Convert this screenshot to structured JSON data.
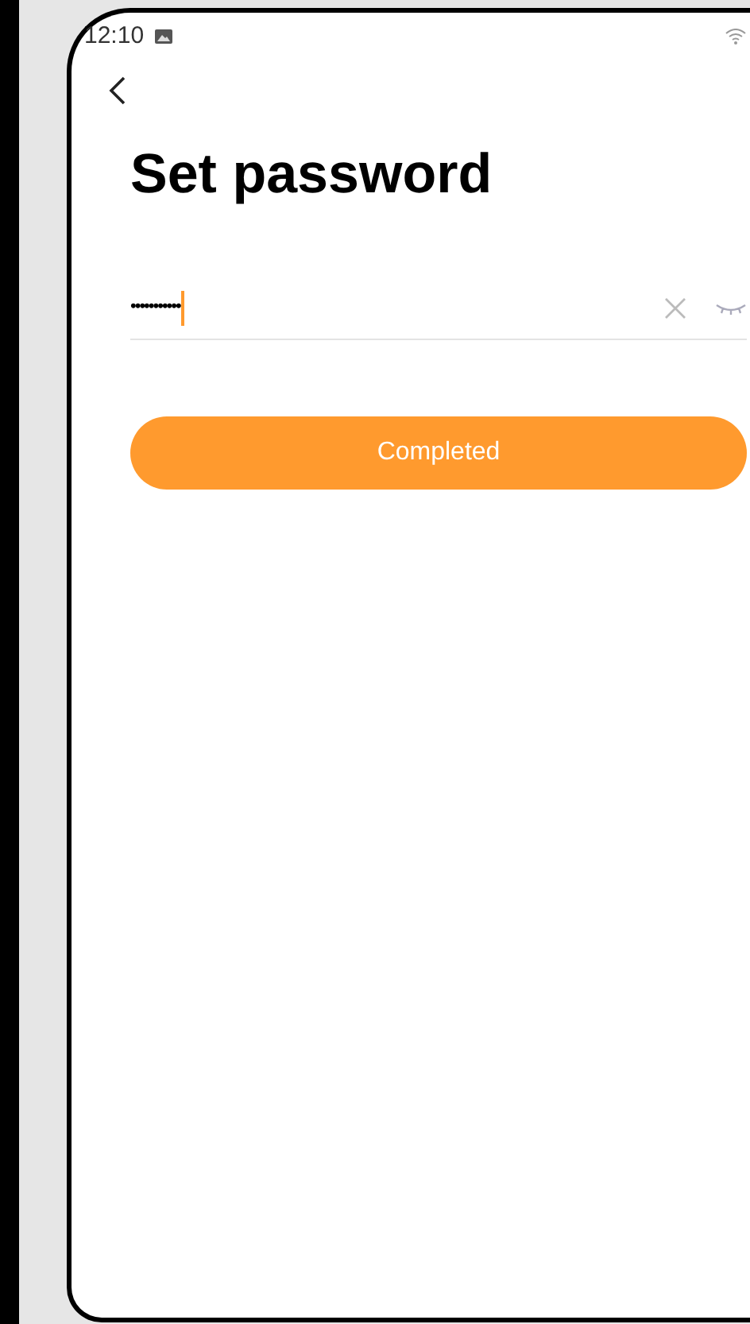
{
  "status_bar": {
    "time": "12:10"
  },
  "title": "Set password",
  "password_field": {
    "value": "•••••••••••",
    "focused": true
  },
  "button": {
    "label": "Completed"
  }
}
